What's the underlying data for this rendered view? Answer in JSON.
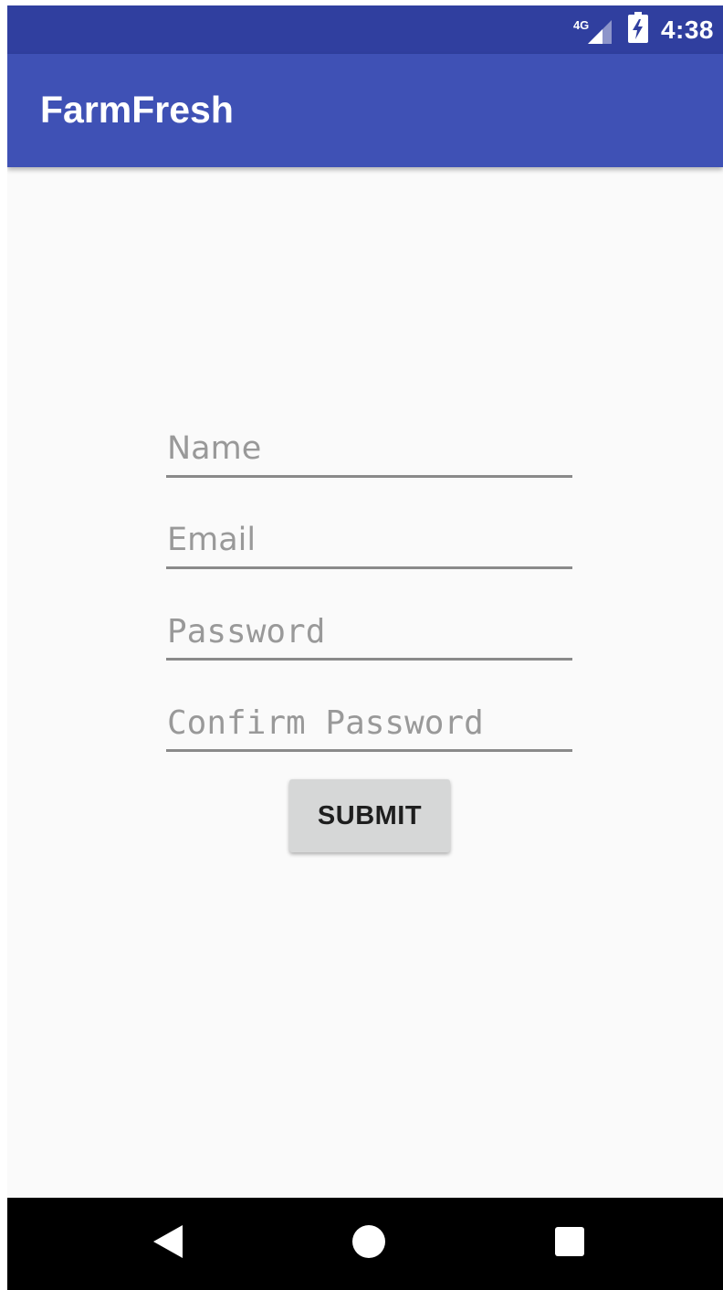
{
  "status_bar": {
    "network_label": "4G",
    "clock": "4:38",
    "signal_icon": "cell-signal-icon",
    "battery_icon": "battery-charging-icon"
  },
  "app_bar": {
    "title": "FarmFresh"
  },
  "form": {
    "name_placeholder": "Name",
    "email_placeholder": "Email",
    "password_placeholder": "Password",
    "confirm_password_placeholder": "Confirm Password",
    "submit_label": "SUBMIT"
  },
  "nav_bar": {
    "back_icon": "back-triangle-icon",
    "home_icon": "home-circle-icon",
    "recents_icon": "recents-square-icon"
  },
  "colors": {
    "status_bar": "#303f9f",
    "app_bar": "#3f51b5",
    "background": "#fafafa",
    "button": "#d6d7d7",
    "nav_bar": "#000000"
  }
}
